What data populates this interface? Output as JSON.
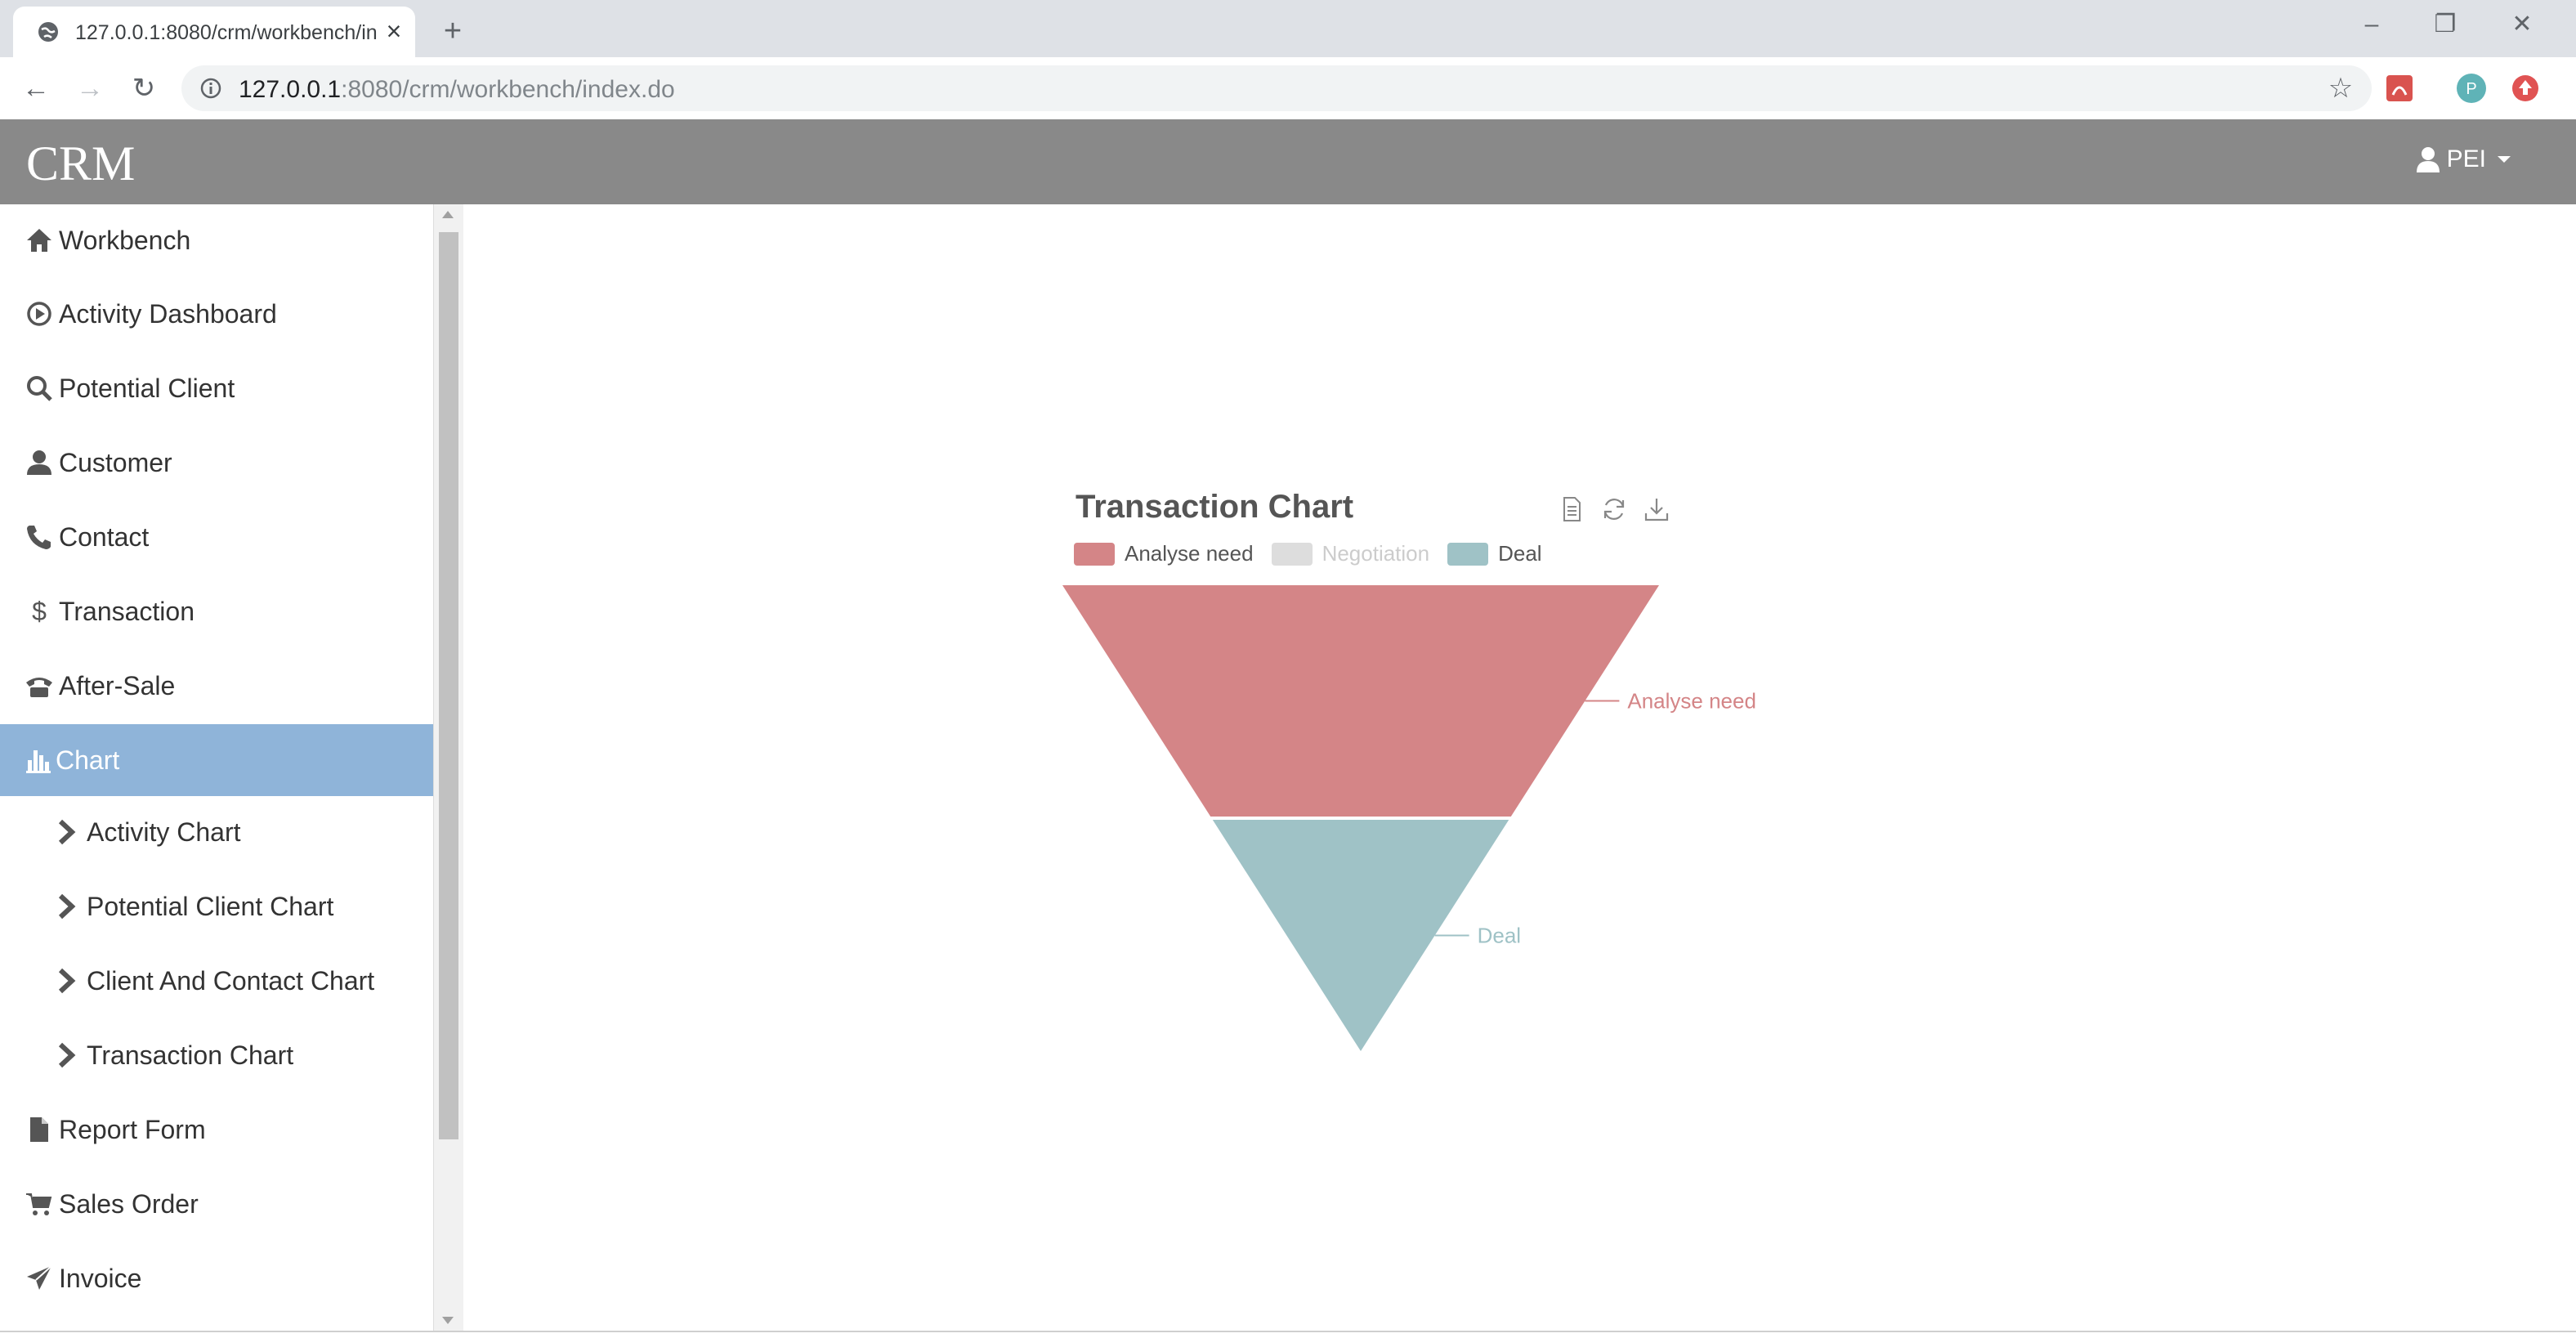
{
  "browser": {
    "tab_title": "127.0.0.1:8080/crm/workbench/index.do",
    "url_host": "127.0.0.1",
    "url_rest": ":8080/crm/workbench/index.do",
    "profile_initial": "P"
  },
  "app": {
    "brand": "CRM",
    "user": "PEI"
  },
  "sidebar": {
    "items": [
      {
        "label": "Workbench",
        "icon": "home-icon"
      },
      {
        "label": "Activity Dashboard",
        "icon": "play-circle-icon"
      },
      {
        "label": "Potential Client",
        "icon": "search-icon"
      },
      {
        "label": "Customer",
        "icon": "user-icon"
      },
      {
        "label": "Contact",
        "icon": "phone-icon"
      },
      {
        "label": "Transaction",
        "icon": "dollar-icon"
      },
      {
        "label": "After-Sale",
        "icon": "telephone-icon"
      },
      {
        "label": "Chart",
        "icon": "bar-chart-icon",
        "active": true
      },
      {
        "label": "Activity Chart",
        "icon": "chevron-right-icon"
      },
      {
        "label": "Potential Client Chart",
        "icon": "chevron-right-icon"
      },
      {
        "label": "Client And Contact Chart",
        "icon": "chevron-right-icon"
      },
      {
        "label": "Transaction Chart",
        "icon": "chevron-right-icon"
      },
      {
        "label": "Report Form",
        "icon": "file-icon"
      },
      {
        "label": "Sales Order",
        "icon": "cart-icon"
      },
      {
        "label": "Invoice",
        "icon": "send-icon"
      }
    ]
  },
  "chart_data": {
    "type": "funnel",
    "title": "Transaction Chart",
    "legend": [
      {
        "name": "Analyse need",
        "color": "#d48587",
        "enabled": true
      },
      {
        "name": "Negotiation",
        "color": "#dddddd",
        "enabled": false
      },
      {
        "name": "Deal",
        "color": "#9fc2c6",
        "enabled": true
      }
    ],
    "series": [
      {
        "name": "Analyse need",
        "color": "#d48587"
      },
      {
        "name": "Deal",
        "color": "#9fc2c6"
      }
    ],
    "labels": [
      "Analyse need",
      "Deal"
    ],
    "toolbox": [
      "data-view-icon",
      "refresh-icon",
      "save-image-icon"
    ]
  }
}
